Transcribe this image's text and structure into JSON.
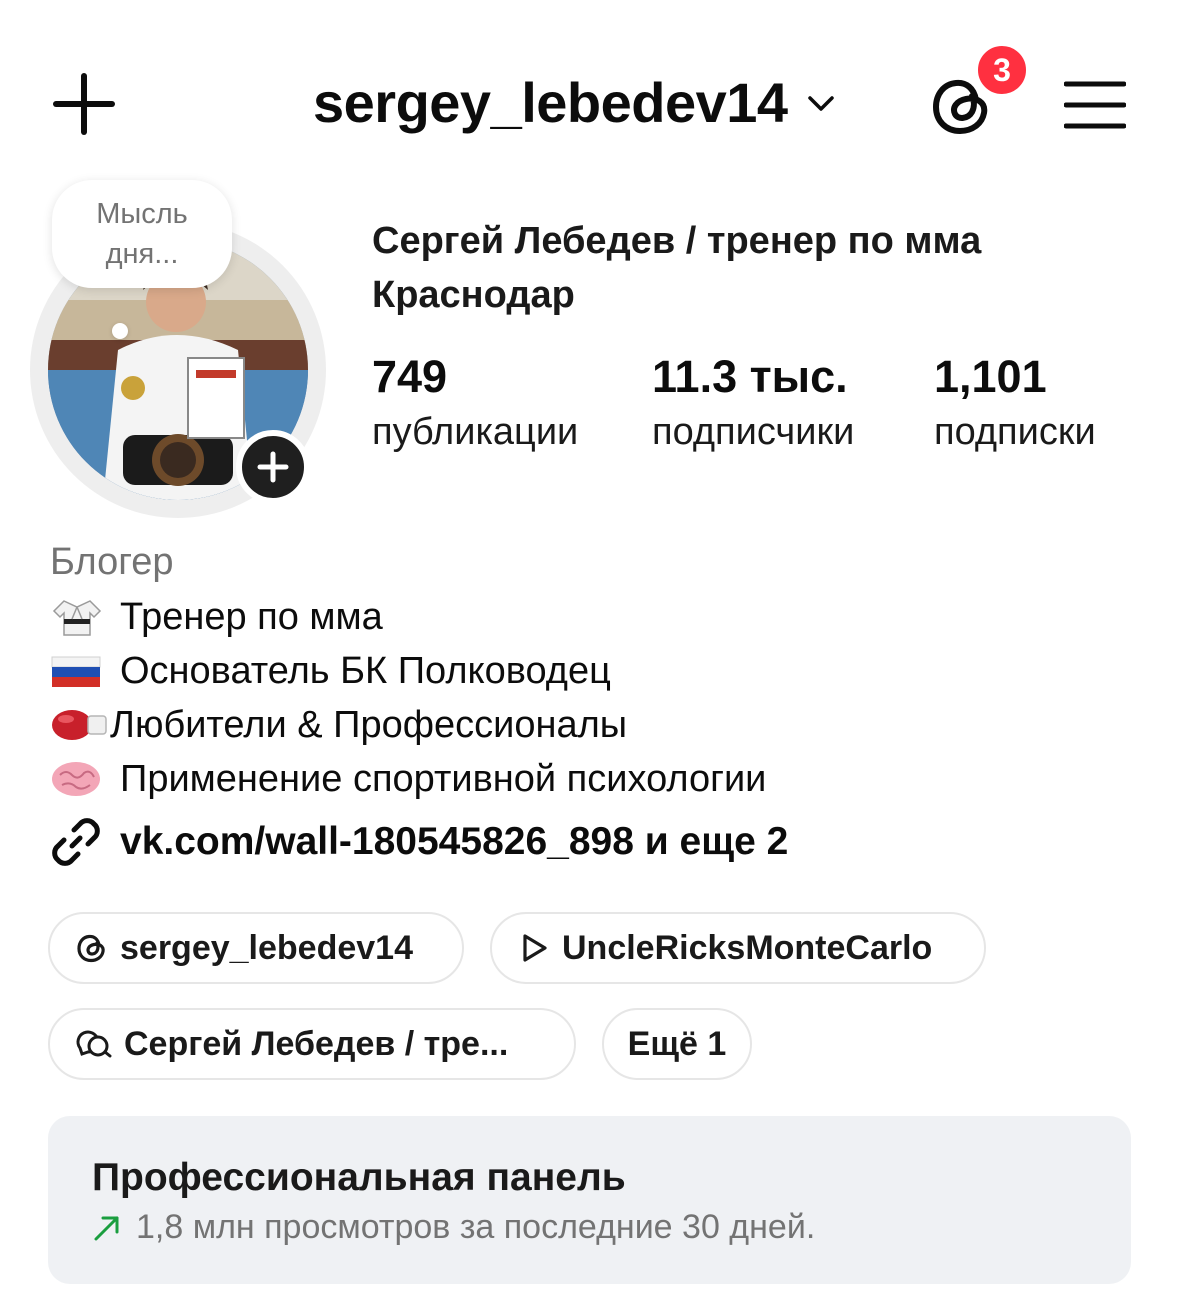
{
  "header": {
    "username": "sergey_lebedev14",
    "notification_count": "3",
    "icons": [
      "plus-icon",
      "chevron-down-icon",
      "threads-icon",
      "menu-icon"
    ]
  },
  "profile": {
    "note": "Мысль дня...",
    "full_name": "Сергей Лебедев / тренер по мма Краснодар",
    "stats": [
      {
        "value": "749",
        "label": "публикации"
      },
      {
        "value": "11.3 тыс.",
        "label": "подписчики"
      },
      {
        "value": "1,101",
        "label": "подписки"
      }
    ]
  },
  "bio": {
    "category": "Блогер",
    "lines": [
      {
        "icon": "kimono-emoji",
        "text": "Тренер по мма"
      },
      {
        "icon": "russia-flag-emoji",
        "text": "Основатель БК Полководец"
      },
      {
        "icon": "boxing-glove-emoji",
        "text": "Любители & Профессионалы"
      },
      {
        "icon": "brain-emoji",
        "text": "Применение спортивной психологии"
      }
    ],
    "link": "vk.com/wall-180545826_898 и еще 2"
  },
  "pills": [
    {
      "icon": "threads-icon",
      "label": "sergey_lebedev14"
    },
    {
      "icon": "play-icon",
      "label": "UncleRicksMonteCarlo"
    },
    {
      "icon": "chat-icon",
      "label": "Сергей Лебедев / тре..."
    },
    {
      "icon": "",
      "label": "Ещё 1"
    }
  ],
  "pro_panel": {
    "title": "Профессиональная панель",
    "subtitle": "1,8 млн просмотров за последние 30 дней.",
    "accent": "#1a9e3f"
  },
  "colors": {
    "badge": "#ff3040",
    "muted_text": "#737373",
    "panel_bg": "#eff1f4"
  }
}
